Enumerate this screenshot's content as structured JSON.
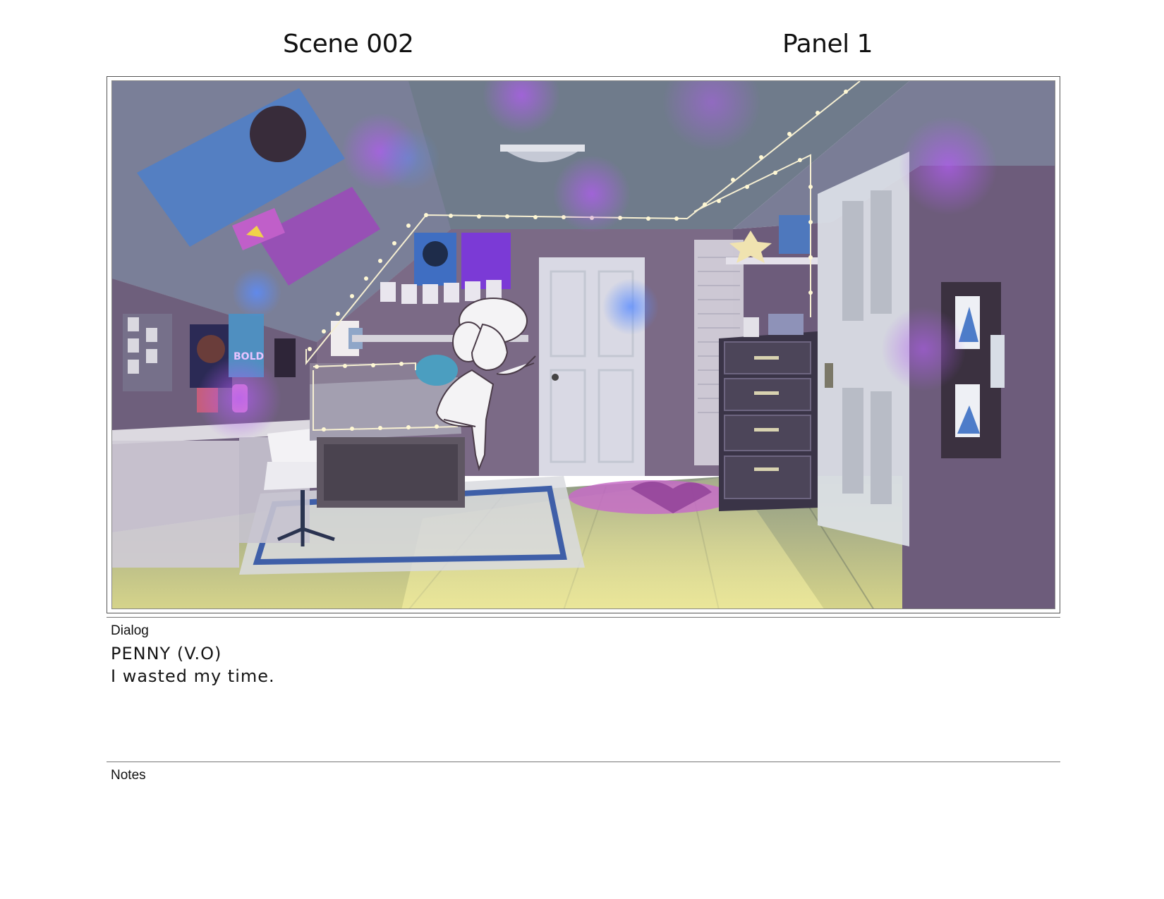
{
  "header": {
    "scene": "Scene 002",
    "panel": "Panel 1"
  },
  "dialog": {
    "label": "Dialog",
    "speaker": "PENNY (V.O)",
    "line": "I wasted my time."
  },
  "notes": {
    "label": "Notes"
  },
  "artwork": {
    "description_icon": "storyboard-illustration",
    "poster_text": "BOLD",
    "colors": {
      "wall": "#6b5d7f",
      "ceiling": "#6e7a8a",
      "floor": "#c9c78a",
      "light_glow": "#a35ae0",
      "string_lights": "#fff4c8"
    }
  }
}
